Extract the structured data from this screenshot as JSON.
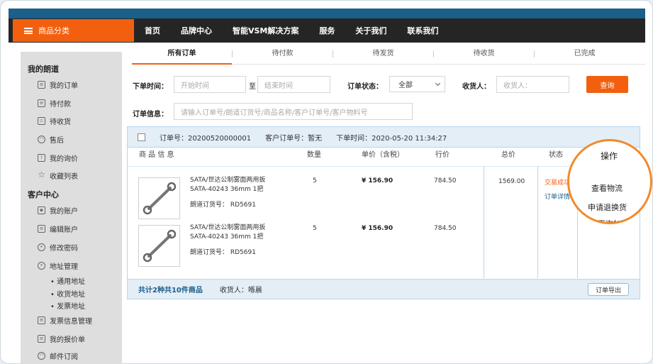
{
  "header": {
    "category_label": "商品分类",
    "nav": [
      "首页",
      "品牌中心",
      "智能VSM解决方案",
      "服务",
      "关于我们",
      "联系我们"
    ]
  },
  "sidebar": {
    "section1": "我的朗道",
    "items1": [
      "我的订单",
      "待付款",
      "待收货",
      "售后",
      "我的询价",
      "收藏列表"
    ],
    "section2": "客户中心",
    "items2": [
      "我的账户",
      "编辑账户",
      "修改密码",
      "地址管理"
    ],
    "sub_items": [
      "• 通用地址",
      "• 收货地址",
      "• 发票地址"
    ],
    "items3": [
      "发票信息管理",
      "我的报价单",
      "邮件订阅"
    ]
  },
  "tabs": [
    "所有订单",
    "待付款",
    "待发货",
    "待收货",
    "已完成"
  ],
  "filters": {
    "time_label": "下单时间：",
    "start_placeholder": "开始时间",
    "to": "至",
    "end_placeholder": "结束时间",
    "status_label": "订单状态：",
    "status_value": "全部",
    "receiver_label": "收货人：",
    "receiver_placeholder": "收货人：",
    "query_button": "查询",
    "info_label": "订单信息：",
    "info_placeholder": "请输入订单号/朗道订货号/商品名称/客户订单号/客户物料号"
  },
  "order": {
    "order_no": "订单号：20200520000001",
    "customer_no": "客户订单号：暂无",
    "order_time": "下单时间：2020-05-20 11:34:27",
    "columns": [
      "商 品 信 息",
      "数量",
      "单价（含税）",
      "行价",
      "总价",
      "状态"
    ],
    "items": [
      {
        "name": "SATA/世达公制雾面两用扳",
        "spec": "SATA-40243 36mm 1把",
        "sku": "朗道订货号： RD5691",
        "qty": "5",
        "price": "¥ 156.90",
        "line": "784.50"
      },
      {
        "name": "SATA/世达公制雾面两用扳",
        "spec": "SATA-40243 36mm 1把",
        "sku": "朗道订货号： RD5691",
        "qty": "5",
        "price": "¥ 156.90",
        "line": "784.50"
      }
    ],
    "total": "1569.00",
    "status": "交易成功",
    "detail_link": "订单详情",
    "summary": "共计2种共10件商品",
    "receiver": "收货人：",
    "receiver_name": "喺晨",
    "export_button": "订单导出"
  },
  "callout": {
    "title": "操作",
    "actions": [
      "查看物流",
      "申请退换货",
      "再次加购"
    ]
  },
  "colors": {
    "accent": "#f2600f",
    "nav_bg": "#252525",
    "top_band": "#1b5f8a",
    "callout_ring": "#f28a2a"
  }
}
